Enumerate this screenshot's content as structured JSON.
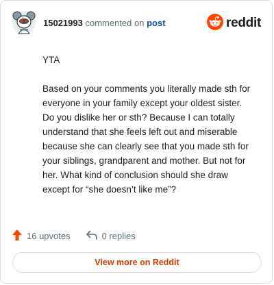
{
  "header": {
    "username": "15021993",
    "commented_on": "commented on",
    "post_link": "post",
    "brand": "reddit",
    "avatar_icon": "snoo-avatar-icon",
    "brand_icon": "reddit-logo-icon"
  },
  "comment": {
    "paragraphs": [
      "YTA",
      "Based on your comments you literally made sth for everyone in your family except your oldest sister. Do you dislike her or sth? Because I can totally understand that she feels left out and miserable because she can clearly see that you made sth for your siblings, grandparent and mother. But not for her. What kind of conclusion should she draw except for “she doesn’t like me”?"
    ]
  },
  "footer": {
    "upvotes": "16 upvotes",
    "replies": "0 replies",
    "upvote_icon": "upvote-arrow-icon",
    "reply_icon": "reply-arrow-icon"
  },
  "view_more": {
    "label": "View more on Reddit"
  },
  "colors": {
    "accent": "#ff4500",
    "link": "#0a4fa6",
    "view_more": "#d23b00",
    "muted": "#576f76"
  }
}
